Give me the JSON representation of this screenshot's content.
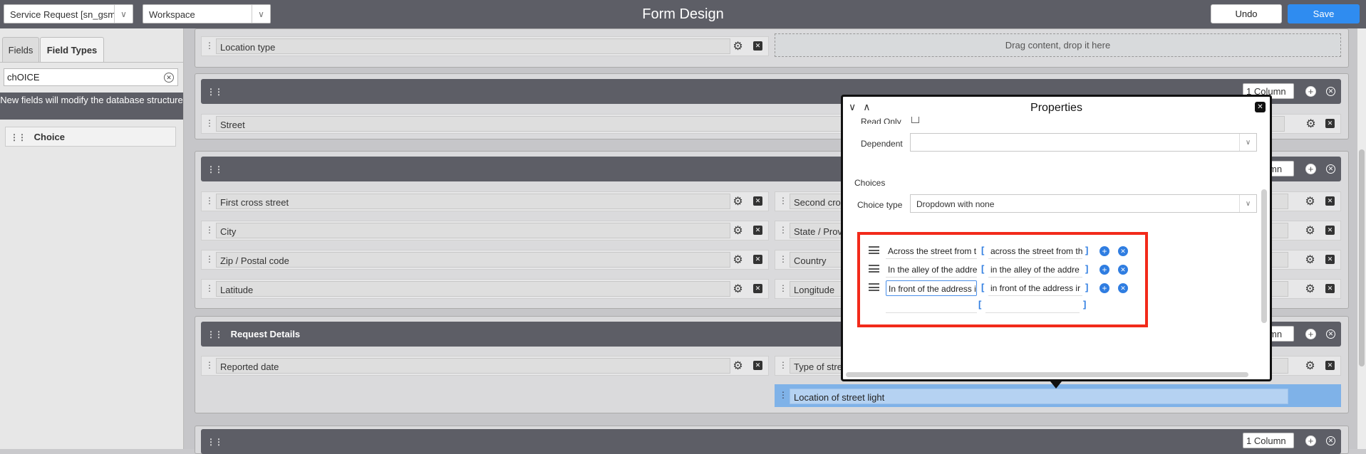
{
  "topbar": {
    "table_select": "Service Request [sn_gsm_",
    "workspace_select": "Workspace",
    "title": "Form Design",
    "undo_label": "Undo",
    "save_label": "Save"
  },
  "left_panel": {
    "tabs": [
      "Fields",
      "Field Types"
    ],
    "active_tab": "Field Types",
    "search_value": "chOICE",
    "warning": "New fields will modify the database structure",
    "items": [
      "Choice"
    ]
  },
  "canvas": {
    "top_fields": {
      "left": "Location type",
      "drop_hint": "Drag content, drop it here"
    },
    "section2": {
      "column_select": "1 Column",
      "field": "Street"
    },
    "section3": {
      "column_select_partial": "mn",
      "left_fields": [
        "First cross street",
        "City",
        "Zip / Postal code",
        "Latitude"
      ],
      "right_fields": [
        "Second cross",
        "State / Provin",
        "Country",
        "Longitude"
      ]
    },
    "request_details": {
      "title": "Request Details",
      "column_select_partial": "mn",
      "left_field": "Reported date",
      "right_field": "Type of stree",
      "selected_field": "Location of street light"
    },
    "bottom_section": {
      "column_select": "1 Column"
    }
  },
  "properties": {
    "title": "Properties",
    "read_only_label": "Read Only",
    "dependent_label": "Dependent",
    "dependent_value": "",
    "choices_heading": "Choices",
    "choice_type_label": "Choice type",
    "choice_type_value": "Dropdown with none",
    "choices": [
      {
        "label": "Across the street from t",
        "value": "across the street from th"
      },
      {
        "label": "In the alley of the addre",
        "value": "in the alley of the addre"
      },
      {
        "label": "In front of the address ir",
        "value": "in front of the address ir"
      }
    ],
    "new_choice": {
      "label": "",
      "value": ""
    }
  },
  "colors": {
    "topbar": "#5d5e66",
    "accent": "#2f8cf0",
    "highlight_border": "#f22a1a",
    "selected_field": "#7fb2e8"
  }
}
